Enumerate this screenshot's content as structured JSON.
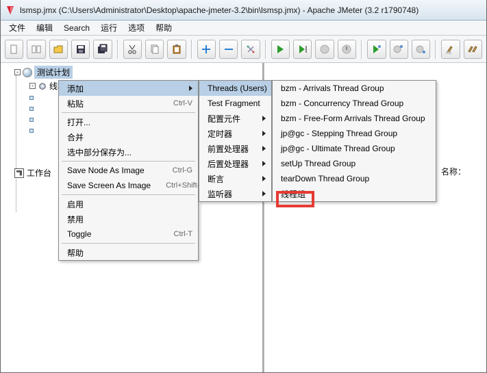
{
  "window": {
    "title": "lsmsp.jmx (C:\\Users\\Administrator\\Desktop\\apache-jmeter-3.2\\bin\\lsmsp.jmx) - Apache JMeter (3.2 r1790748)"
  },
  "menubar": {
    "file": "文件",
    "edit": "编辑",
    "search": "Search",
    "run": "运行",
    "options": "选项",
    "help": "帮助"
  },
  "tree": {
    "root": "测试计划",
    "child1_partial": "线程",
    "workbench": "工作台"
  },
  "right": {
    "name_label": "名称："
  },
  "ctx1": {
    "add": "添加",
    "paste": "粘贴",
    "paste_sc": "Ctrl-V",
    "open": "打开...",
    "merge": "合并",
    "save_sel": "选中部分保存为...",
    "save_node": "Save Node As Image",
    "save_node_sc": "Ctrl-G",
    "save_screen": "Save Screen As Image",
    "save_screen_sc": "Ctrl+Shift-G",
    "enable": "启用",
    "disable": "禁用",
    "toggle": "Toggle",
    "toggle_sc": "Ctrl-T",
    "help": "帮助"
  },
  "ctx2": {
    "threads": "Threads (Users)",
    "fragment": "Test Fragment",
    "config": "配置元件",
    "timer": "定时器",
    "pre": "前置处理器",
    "post": "后置处理器",
    "assert": "断言",
    "listener": "监听器"
  },
  "ctx3": {
    "bzm_arr": "bzm - Arrivals Thread Group",
    "bzm_con": "bzm - Concurrency Thread Group",
    "bzm_free": "bzm - Free-Form Arrivals Thread Group",
    "jp_step": "jp@gc - Stepping Thread Group",
    "jp_ult": "jp@gc - Ultimate Thread Group",
    "setup": "setUp Thread Group",
    "teardown": "tearDown Thread Group",
    "tg": "线程组"
  }
}
